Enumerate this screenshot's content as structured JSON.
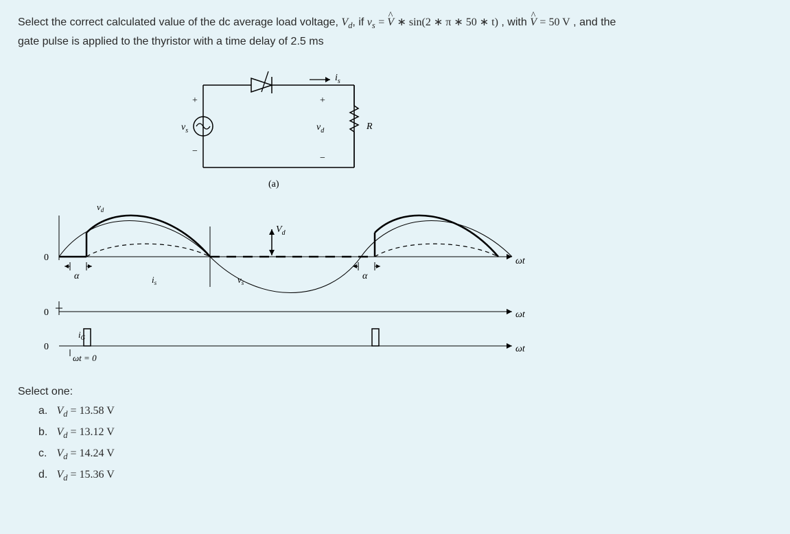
{
  "question": {
    "line1_prefix": "Select the correct calculated value of the dc average load voltage, ",
    "vd_label": "V",
    "vd_sub": "d",
    "if_text": ", if ",
    "vs_label": "v",
    "vs_sub": "s",
    "eq_text": " = ",
    "vhat": "V",
    "sin_text": " ∗ sin(2 ∗ π ∗ 50 ∗ t)",
    "with_text": ", with ",
    "vhat2": "V",
    "eq50": " = 50 V",
    "and_text": ", and the",
    "line2": "gate pulse is applied to the thyristor with a time delay of 2.5 ms"
  },
  "circuit": {
    "plus1": "+",
    "minus1": "−",
    "vs": "v",
    "vs_sub": "s",
    "plus2": "+",
    "minus2": "−",
    "vd": "v",
    "vd_sub": "d",
    "is": "i",
    "is_sub": "s",
    "R": "R",
    "caption": "(a)"
  },
  "waveform": {
    "zero1": "0",
    "zero2": "0",
    "zero3": "0",
    "vd_small": "v",
    "vd_small_sub": "d",
    "Vd_cap": "V",
    "Vd_cap_sub": "d",
    "alpha1": "α",
    "alpha2": "α",
    "is": "i",
    "is_sub": "s",
    "vs": "v",
    "vs_sub": "s",
    "ig": "i",
    "ig_sub": "G",
    "wt0": "ωt = 0",
    "wt1": "ωt",
    "wt2": "ωt",
    "wt3": "ωt"
  },
  "select_label": "Select one:",
  "options": [
    {
      "letter": "a.",
      "var": "V",
      "sub": "d",
      "val": " = 13.58 V"
    },
    {
      "letter": "b.",
      "var": "V",
      "sub": "d",
      "val": " = 13.12 V"
    },
    {
      "letter": "c.",
      "var": "V",
      "sub": "d",
      "val": " = 14.24 V"
    },
    {
      "letter": "d.",
      "var": "V",
      "sub": "d",
      "val": " = 15.36 V"
    }
  ]
}
